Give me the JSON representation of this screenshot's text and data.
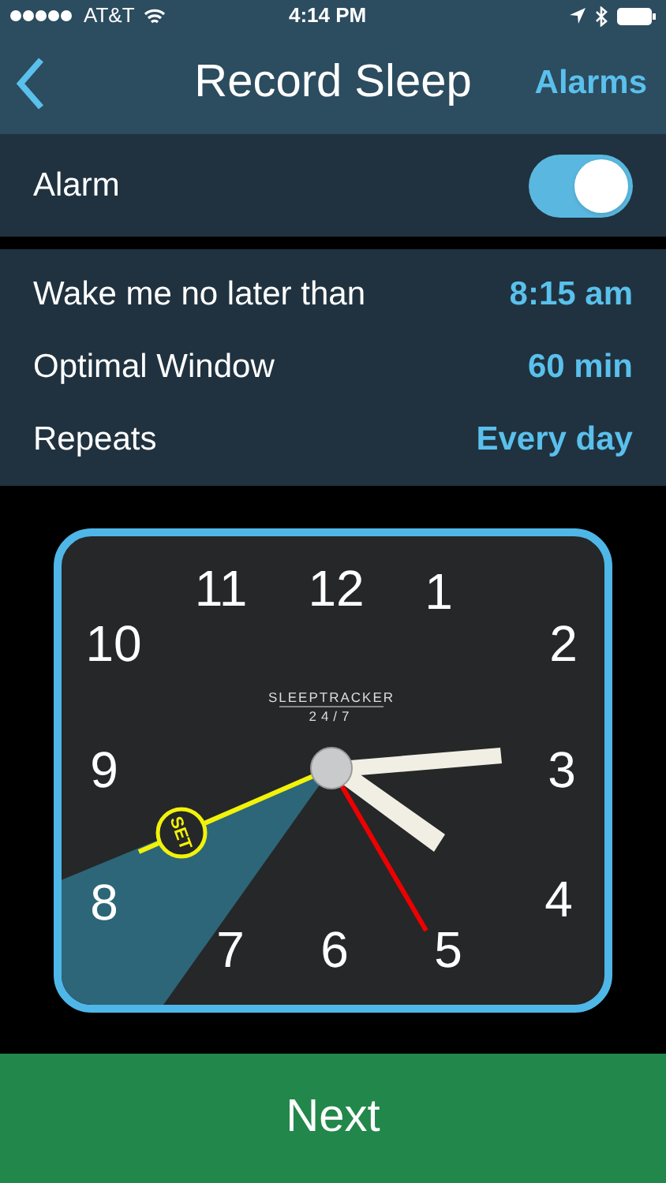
{
  "status_bar": {
    "carrier": "AT&T",
    "time": "4:14 PM"
  },
  "nav": {
    "title": "Record Sleep",
    "right_action": "Alarms"
  },
  "alarm": {
    "label": "Alarm",
    "on": true
  },
  "settings": [
    {
      "label": "Wake me no later than",
      "value": "8:15 am"
    },
    {
      "label": "Optimal Window",
      "value": "60 min"
    },
    {
      "label": "Repeats",
      "value": "Every day"
    }
  ],
  "clock": {
    "brand": "SLEEPTRACKER",
    "brand_sub": "24/7",
    "set_label": "SET",
    "numerals": [
      "11",
      "12",
      "1",
      "10",
      "2",
      "9",
      "3",
      "8",
      "4",
      "7",
      "6",
      "5"
    ]
  },
  "next_button": "Next"
}
